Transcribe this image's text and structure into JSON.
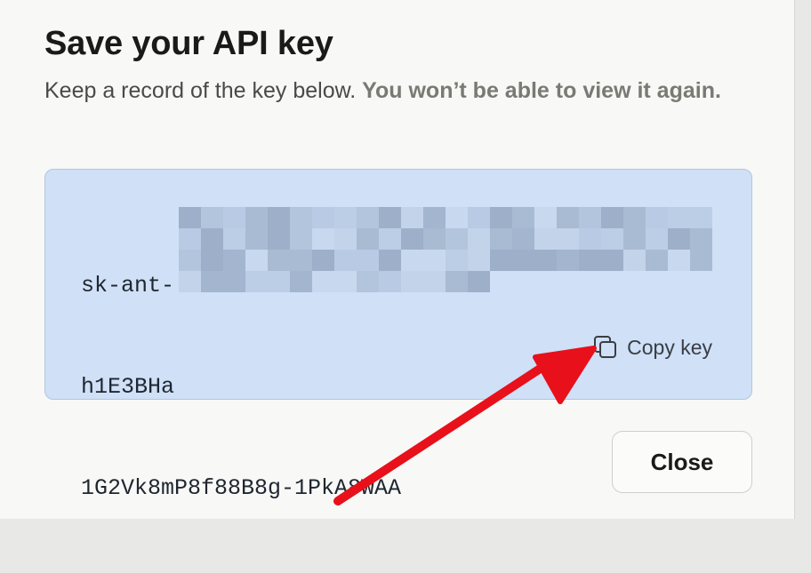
{
  "modal": {
    "title": "Save your API key",
    "subtitle_main": "Keep a record of the key below. ",
    "subtitle_warning": "You won’t be able to view it again."
  },
  "api_key": {
    "lines": [
      "sk-ant-",
      "h1E3BHa",
      "1G2Vk8mP8f88B8g-1PkA8WAA"
    ],
    "redacted": true
  },
  "copy_button": {
    "label": "Copy key",
    "icon": "copy-icon"
  },
  "close_button": {
    "label": "Close"
  },
  "colors": {
    "key_box_bg": "#cfe0f7",
    "annotation_arrow": "#e8101a"
  }
}
